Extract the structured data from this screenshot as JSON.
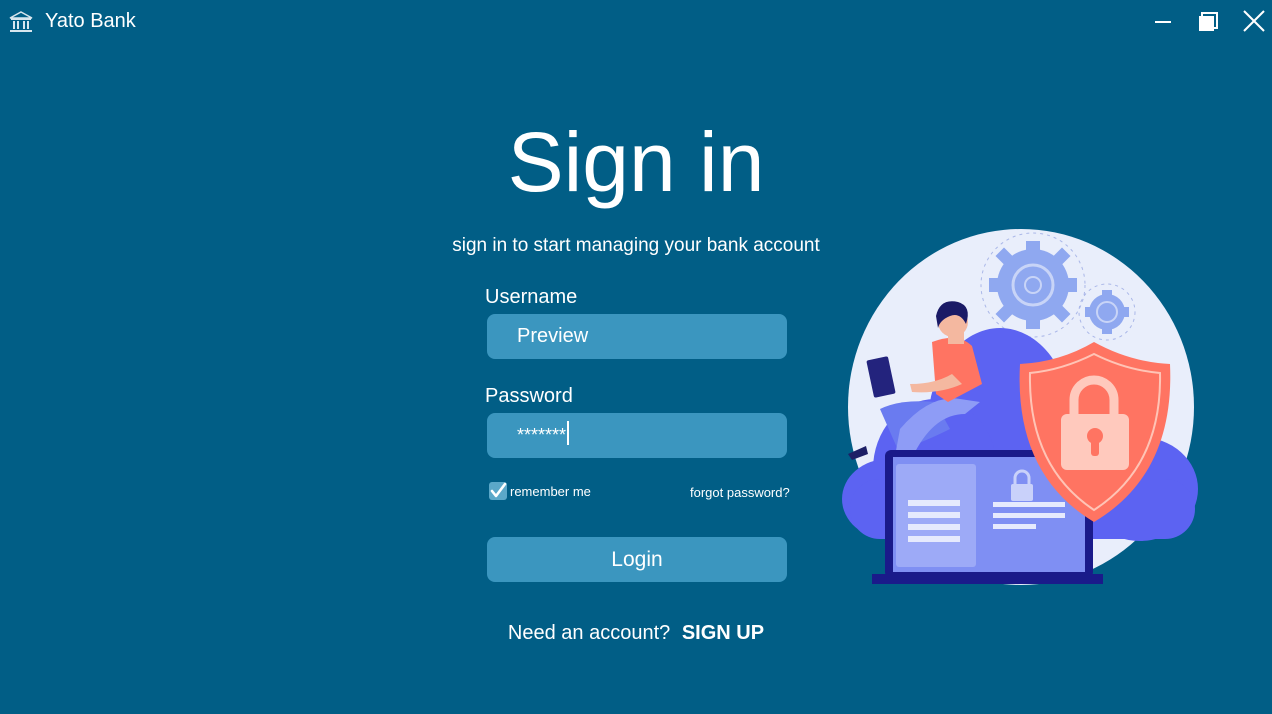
{
  "window": {
    "title": "Yato Bank",
    "app_icon": "bank-icon",
    "controls": [
      "minimize-icon",
      "maximize-icon",
      "close-icon"
    ]
  },
  "heading": "Sign in",
  "subheading": "sign in to start managing your bank account",
  "username": {
    "label": "Username",
    "value": "Preview"
  },
  "password": {
    "label": "Password",
    "value": "*******"
  },
  "remember": {
    "label": "remember me",
    "checked": true
  },
  "forgot_label": "forgot password?",
  "login_label": "Login",
  "signup": {
    "prompt": "Need an account?",
    "link": "SIGN UP"
  },
  "illustration": "security-illustration",
  "colors": {
    "background": "#015e86",
    "field": "#3b96bf",
    "text": "#ffffff",
    "shield": "#ff7462",
    "cloud": "#5c63f2"
  }
}
